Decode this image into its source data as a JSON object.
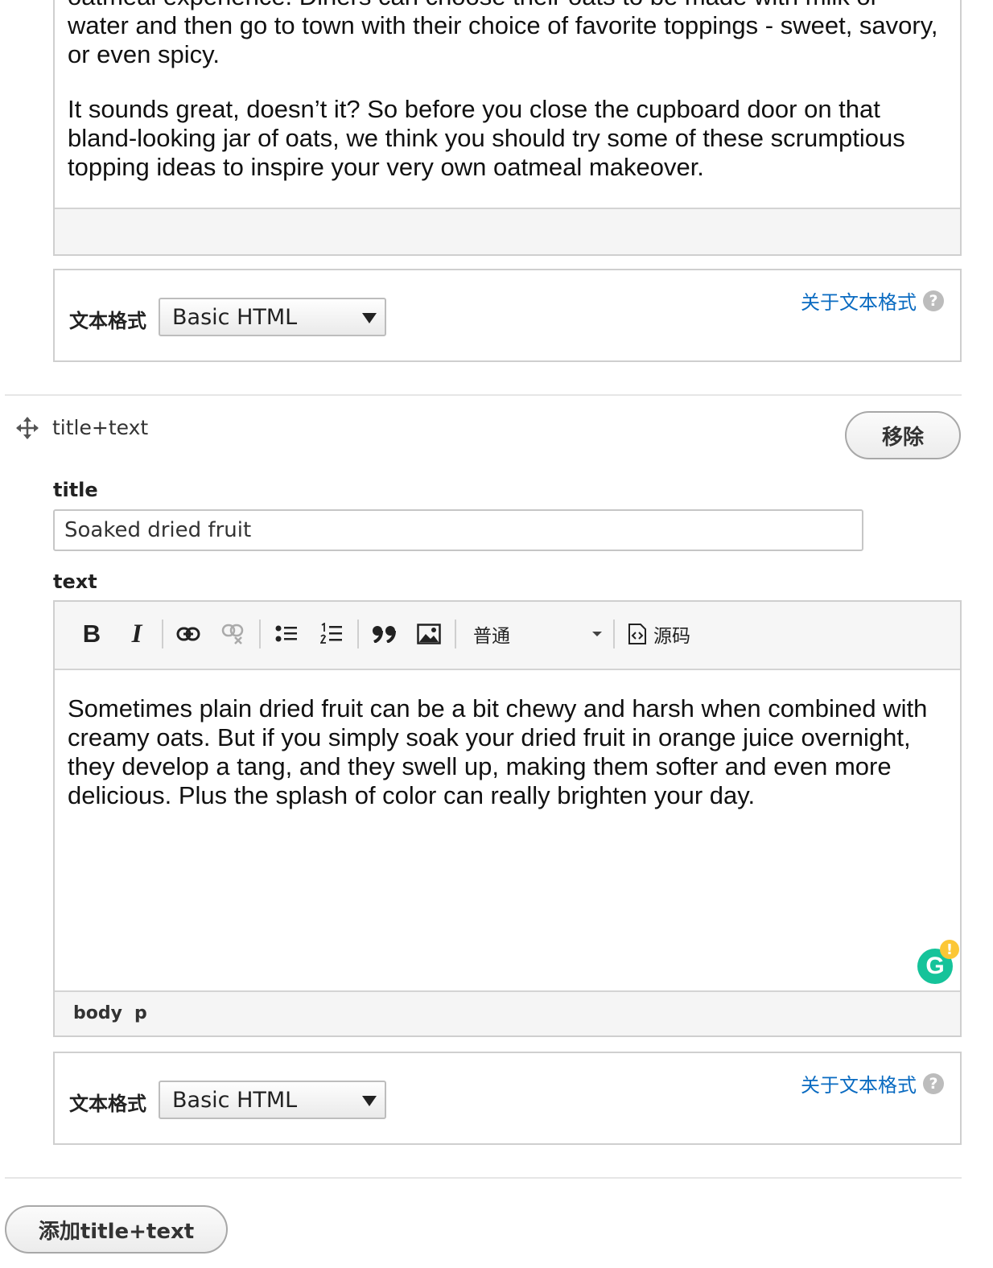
{
  "editor1": {
    "partial_line": "oatmeal experience. Diners can choose their oats to be made with milk or",
    "paragraphs": [
      "water and then go to town with their choice of favorite toppings - sweet, savory, or even spicy.",
      "It sounds great, doesn’t it? So before you close the cupboard door on that bland-looking jar of oats, we think you should try some of these scrumptious topping ideas to inspire your very own oatmeal makeover."
    ]
  },
  "format1": {
    "label": "文本格式",
    "selected": "Basic HTML",
    "about_link": "关于文本格式",
    "help_glyph": "?"
  },
  "item": {
    "type_label": "title+text",
    "remove_label": "移除",
    "title_label": "title",
    "title_value": "Soaked dried fruit",
    "text_label": "text"
  },
  "toolbar": {
    "bold": "B",
    "italic": "I",
    "paragraph_format": "普通",
    "source_label": "源码"
  },
  "editor2": {
    "paragraph": "Sometimes plain dried fruit can be a bit chewy and harsh when combined with creamy oats. But if you simply soak your dried fruit in orange juice overnight, they develop a tang, and they swell up, making them softer and even more delicious. Plus the splash of color can really brighten your day.",
    "status_path": [
      "body",
      "p"
    ],
    "grammarly_glyph": "G",
    "grammarly_alert": "!"
  },
  "format2": {
    "label": "文本格式",
    "selected": "Basic HTML",
    "about_link": "关于文本格式",
    "help_glyph": "?"
  },
  "add_button_label": "添加title+text",
  "colors": {
    "link": "#0a6bc1",
    "grammarly": "#15c39a",
    "grammarly_alert": "#fcc736"
  }
}
